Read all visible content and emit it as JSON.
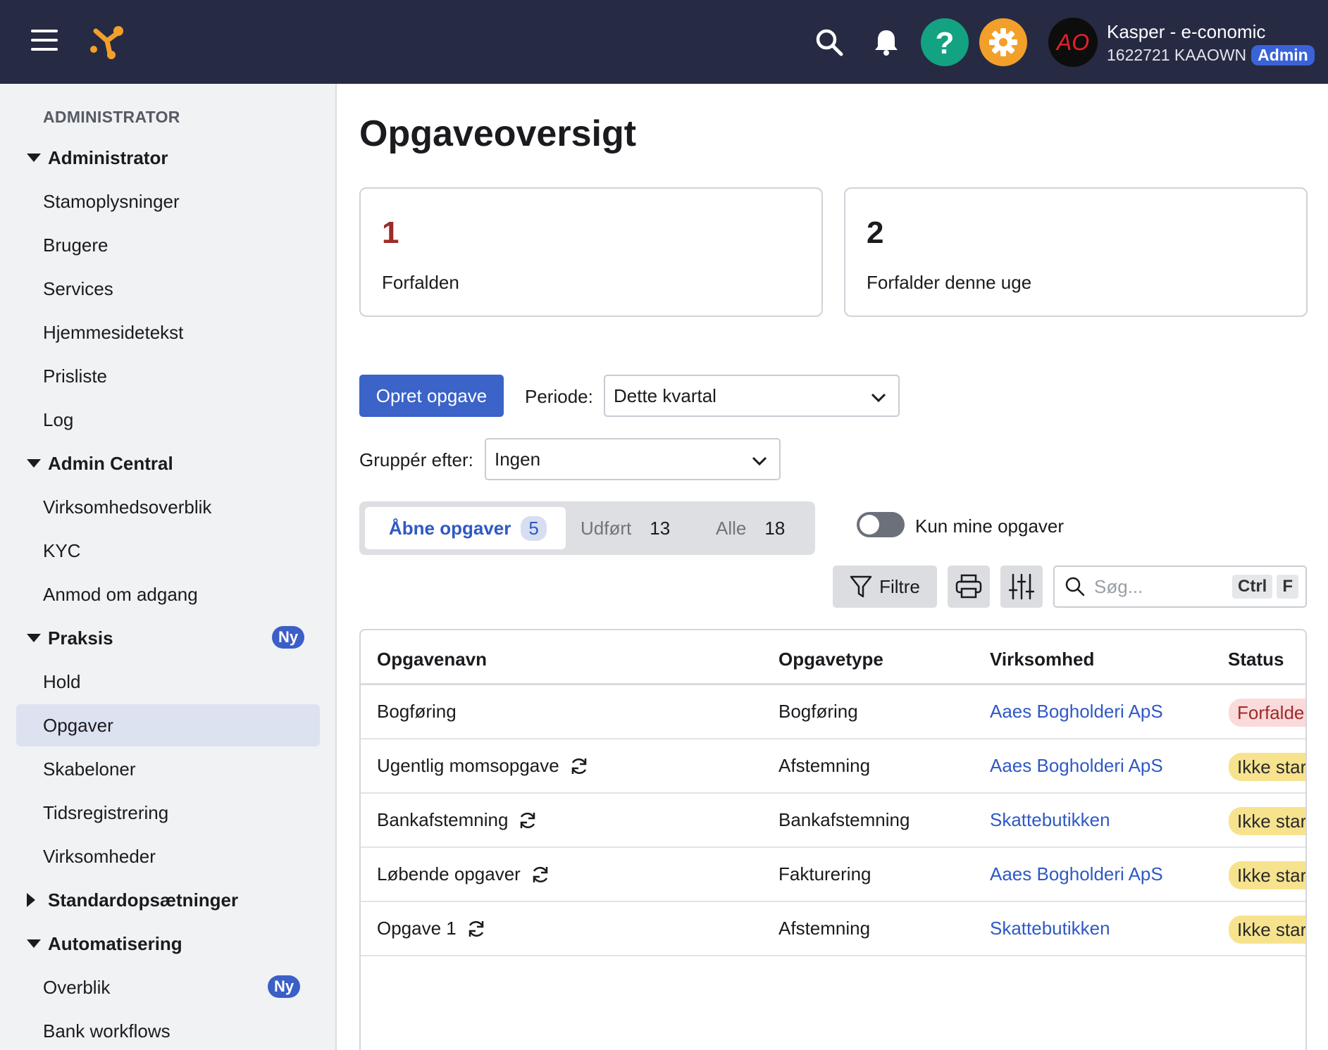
{
  "header": {
    "user_name": "Kasper - e-conomic",
    "user_account": "1622721 KAAOWN",
    "user_role": "Admin",
    "avatar_text": "AO"
  },
  "sidebar": {
    "heading": "ADMINISTRATOR",
    "groups": [
      {
        "label": "Administrator",
        "expanded": true,
        "items": [
          "Stamoplysninger",
          "Brugere",
          "Services",
          "Hjemmesidetekst",
          "Prisliste",
          "Log"
        ]
      },
      {
        "label": "Admin Central",
        "expanded": true,
        "items": [
          "Virksomhedsoverblik",
          "KYC",
          "Anmod om adgang"
        ]
      },
      {
        "label": "Praksis",
        "expanded": true,
        "badge": "Ny",
        "items": [
          "Hold",
          "Opgaver",
          "Skabeloner",
          "Tidsregistrering",
          "Virksomheder"
        ],
        "active_item": "Opgaver"
      },
      {
        "label": "Standardopsætninger",
        "expanded": false,
        "items": []
      },
      {
        "label": "Automatisering",
        "expanded": true,
        "items": [
          "Overblik",
          "Bank workflows"
        ],
        "item_badges": {
          "Overblik": "Ny"
        }
      }
    ]
  },
  "main": {
    "title": "Opgaveoversigt",
    "cards": [
      {
        "number": "1",
        "label": "Forfalden",
        "color": "#9e2b2b"
      },
      {
        "number": "2",
        "label": "Forfalder denne uge",
        "color": "#1b1b1f"
      }
    ],
    "create_button": "Opret opgave",
    "period_label": "Periode:",
    "period_value": "Dette kvartal",
    "group_label": "Gruppér efter:",
    "group_value": "Ingen",
    "tabs": [
      {
        "label": "Åbne opgaver",
        "count": "5",
        "active": true
      },
      {
        "label": "Udført",
        "count": "13",
        "active": false
      },
      {
        "label": "Alle",
        "count": "18",
        "active": false
      }
    ],
    "only_mine_label": "Kun mine opgaver",
    "only_mine_on": false,
    "filter_button": "Filtre",
    "search_placeholder": "Søg...",
    "shortcut_keys": [
      "Ctrl",
      "F"
    ]
  },
  "table": {
    "columns": [
      "Opgavenavn",
      "Opgavetype",
      "Virksomhed",
      "Status"
    ],
    "rows": [
      {
        "name": "Bogføring",
        "recurring": false,
        "type": "Bogføring",
        "company": "Aaes Bogholderi ApS",
        "status": "Forfalden",
        "status_kind": "overdue"
      },
      {
        "name": "Ugentlig momsopgave",
        "recurring": true,
        "type": "Afstemning",
        "company": "Aaes Bogholderi ApS",
        "status": "Ikke startet",
        "status_kind": "notstarted"
      },
      {
        "name": "Bankafstemning",
        "recurring": true,
        "type": "Bankafstemning",
        "company": "Skattebutikken",
        "status": "Ikke startet",
        "status_kind": "notstarted"
      },
      {
        "name": "Løbende opgaver",
        "recurring": true,
        "type": "Fakturering",
        "company": "Aaes Bogholderi ApS",
        "status": "Ikke startet",
        "status_kind": "notstarted"
      },
      {
        "name": "Opgave 1",
        "recurring": true,
        "type": "Afstemning",
        "company": "Skattebutikken",
        "status": "Ikke startet",
        "status_kind": "notstarted"
      }
    ]
  },
  "colors": {
    "topbar": "#272a43",
    "primary": "#3b63c8",
    "link": "#2f59c4",
    "help": "#13a382",
    "settings": "#f2a02a"
  }
}
